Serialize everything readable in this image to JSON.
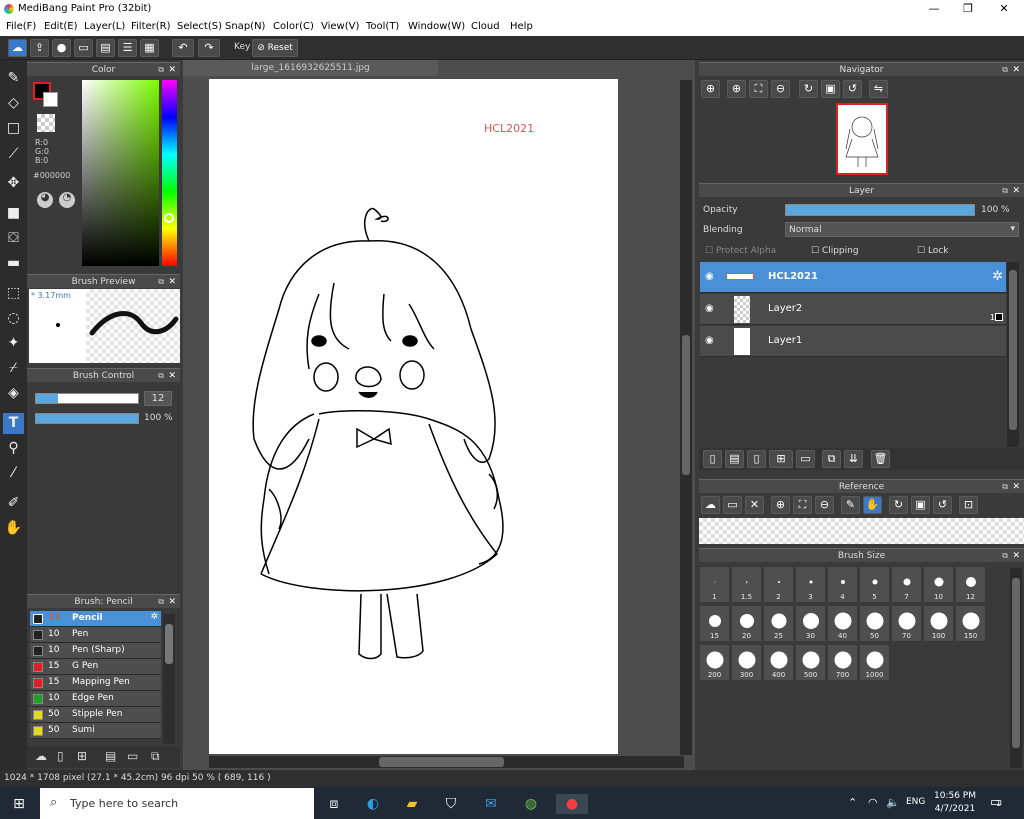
{
  "window": {
    "title": "MediBang Paint Pro (32bit)",
    "controls": [
      "—",
      "❐",
      "✕"
    ]
  },
  "menu": [
    "File(F)",
    "Edit(E)",
    "Layer(L)",
    "Filter(R)",
    "Select(S)",
    "Snap(N)",
    "Color(C)",
    "View(V)",
    "Tool(T)",
    "Window(W)",
    "Cloud",
    "Help"
  ],
  "toolbar": {
    "key_label": "Key",
    "reset_label": "Reset"
  },
  "color_panel": {
    "title": "Color",
    "r": "R:0",
    "g": "G:0",
    "b": "B:0",
    "hex": "#000000",
    "fg": "#000000",
    "accent_border": "#e02020"
  },
  "brush_preview": {
    "title": "Brush Preview",
    "size": "* 3.17mm"
  },
  "brush_control": {
    "title": "Brush Control",
    "size_value": "12",
    "opacity_value": "100 %"
  },
  "brush_list": {
    "title": "Brush: Pencil",
    "items": [
      {
        "size": "12",
        "name": "Pencil",
        "color": "#222222",
        "selected": true
      },
      {
        "size": "10",
        "name": "Pen",
        "color": "#222222"
      },
      {
        "size": "10",
        "name": "Pen (Sharp)",
        "color": "#222222"
      },
      {
        "size": "15",
        "name": "G Pen",
        "color": "#e02020"
      },
      {
        "size": "15",
        "name": "Mapping Pen",
        "color": "#e02020"
      },
      {
        "size": "10",
        "name": "Edge Pen",
        "color": "#20a020"
      },
      {
        "size": "50",
        "name": "Stipple Pen",
        "color": "#e8d820"
      },
      {
        "size": "50",
        "name": "Sumi",
        "color": "#e8d820"
      }
    ]
  },
  "canvas": {
    "tab": "large_1616932625511.jpg",
    "watermark": "HCL2021"
  },
  "navigator": {
    "title": "Navigator"
  },
  "layer_panel": {
    "title": "Layer",
    "opacity_label": "Opacity",
    "opacity_value": "100 %",
    "opacity_fraction": 1.0,
    "blending_label": "Blending",
    "blending_value": "Normal",
    "protect_alpha": "Protect Alpha",
    "clipping": "Clipping",
    "lock": "Lock",
    "layers": [
      {
        "name": "HCL2021",
        "selected": true
      },
      {
        "name": "Layer2",
        "extra": "1"
      },
      {
        "name": "Layer1"
      }
    ]
  },
  "reference": {
    "title": "Reference"
  },
  "brush_size": {
    "title": "Brush Size",
    "sizes": [
      "1",
      "1.5",
      "2",
      "3",
      "4",
      "5",
      "7",
      "10",
      "12",
      "15",
      "20",
      "25",
      "30",
      "40",
      "50",
      "70",
      "100",
      "150",
      "200",
      "300",
      "400",
      "500",
      "700",
      "1000"
    ]
  },
  "status": {
    "text": "1024 * 1708 pixel  (27.1 * 45.2cm)  96 dpi  50 %  ( 689, 116 )"
  },
  "taskbar": {
    "search_placeholder": "Type here to search",
    "lang": "ENG",
    "time": "10:56 PM",
    "date": "4/7/2021",
    "notif": "1"
  }
}
